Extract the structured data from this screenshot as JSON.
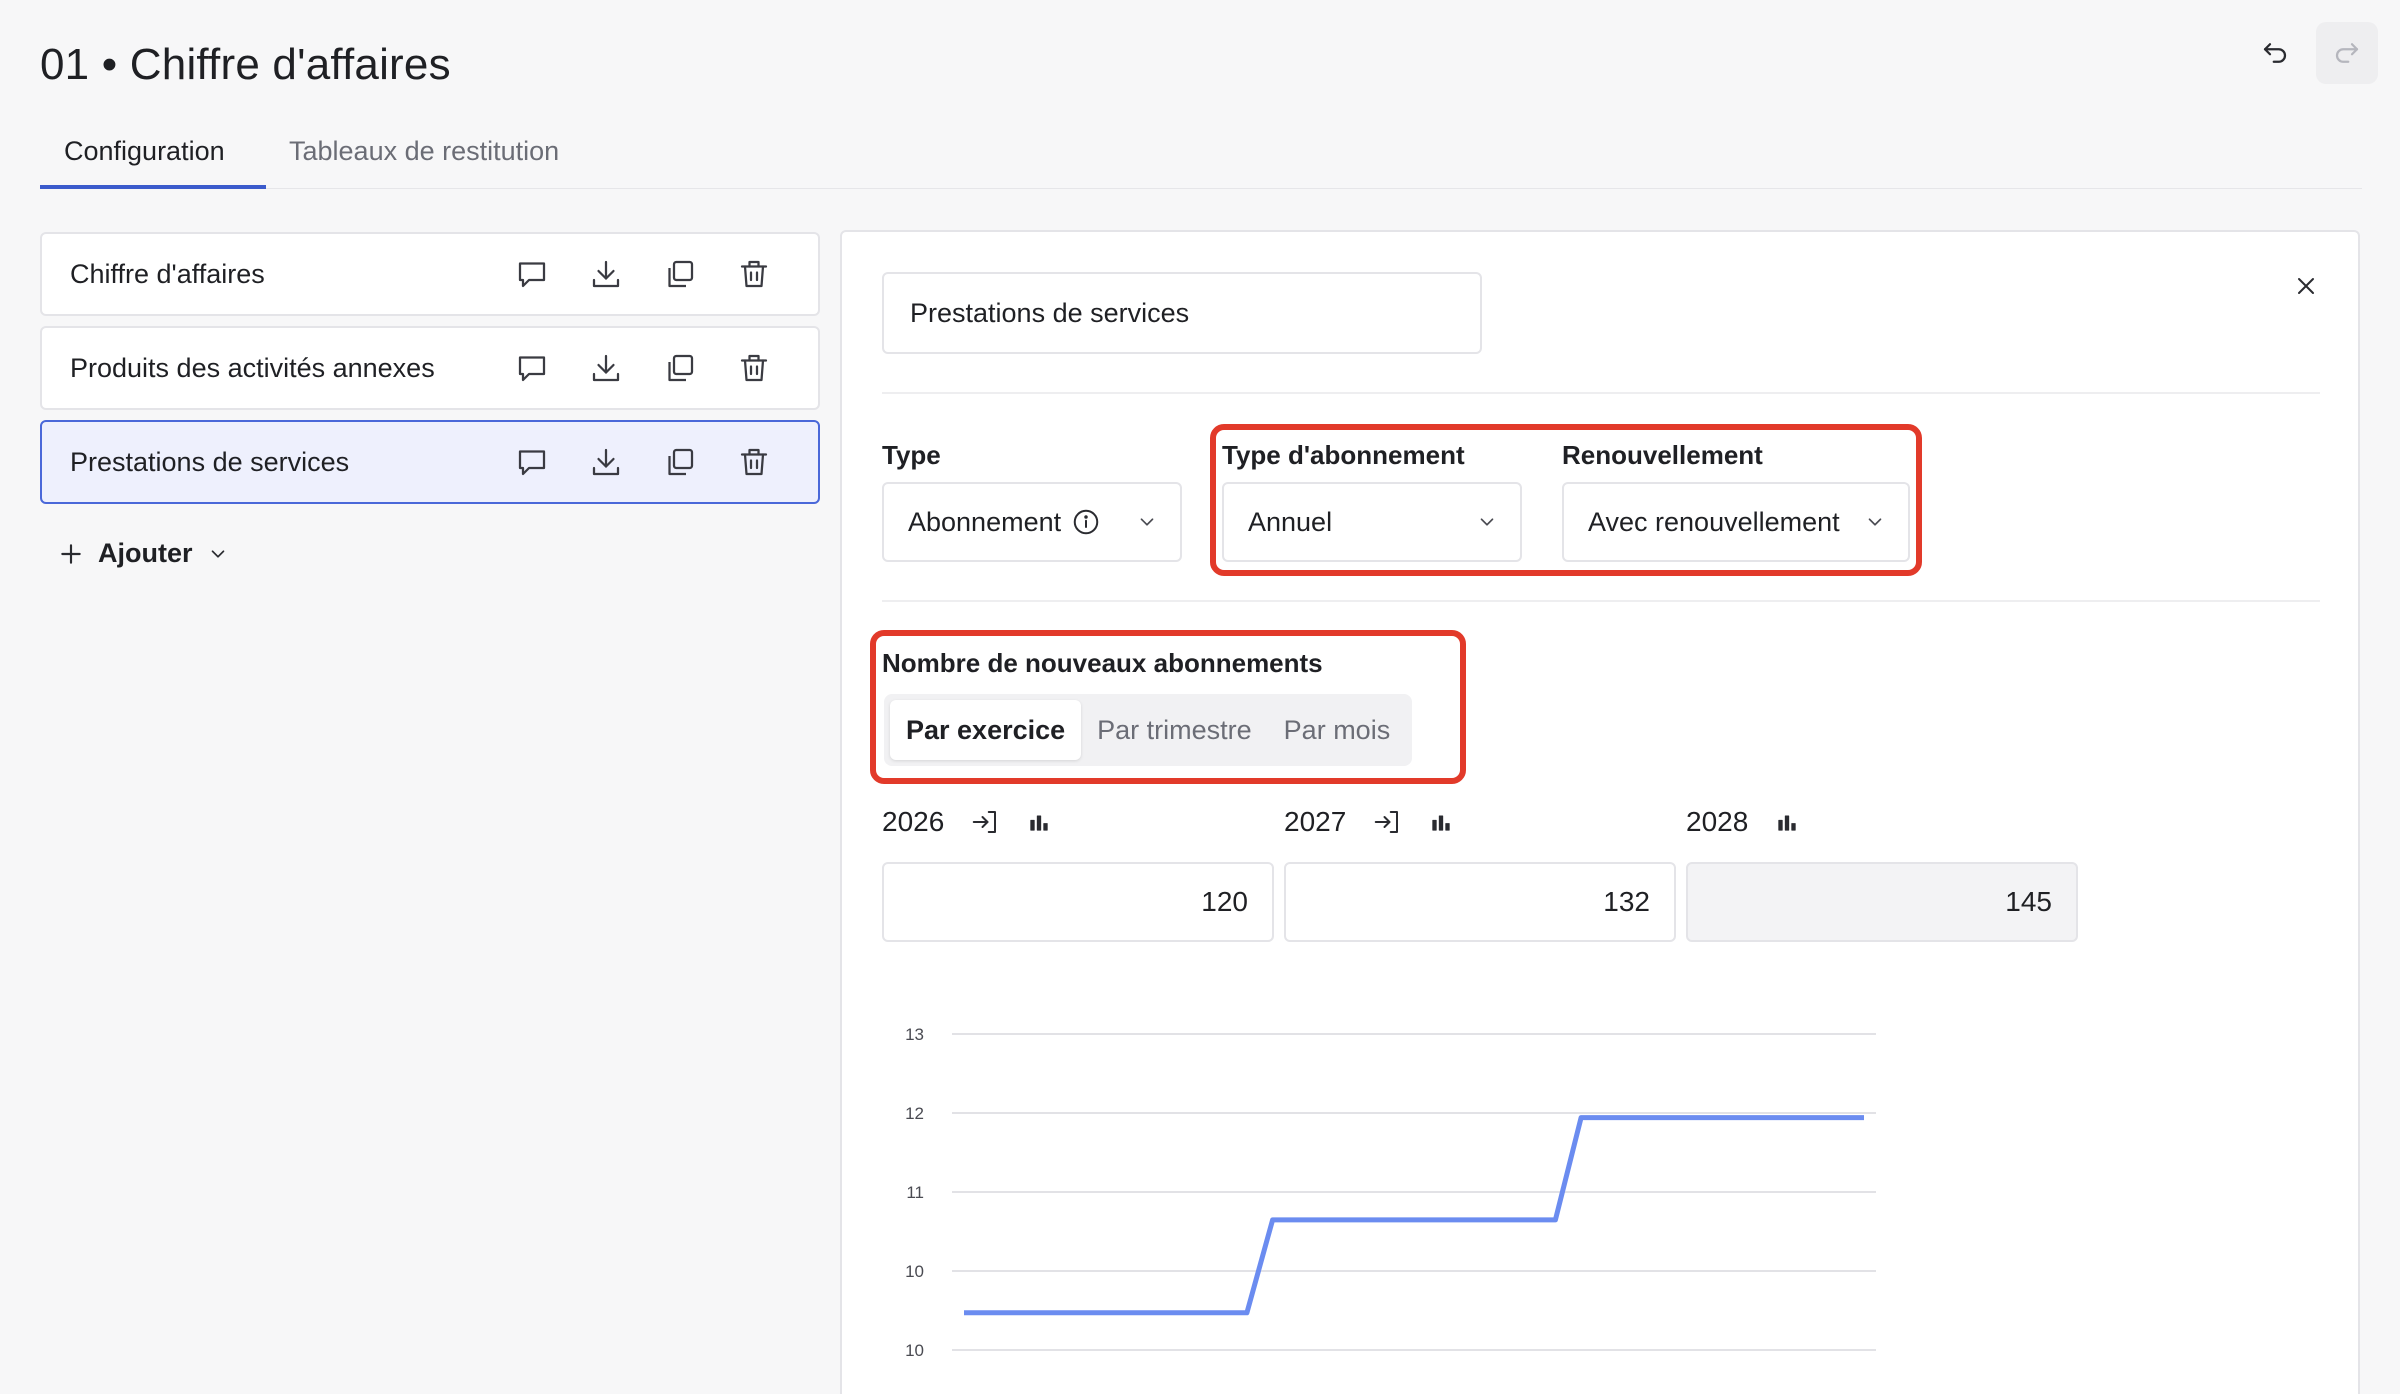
{
  "header": {
    "title": "01 • Chiffre d'affaires",
    "tabs": [
      {
        "label": "Configuration",
        "active": true
      },
      {
        "label": "Tableaux de restitution",
        "active": false
      }
    ]
  },
  "sidebar": {
    "items": [
      {
        "label": "Chiffre d'affaires",
        "selected": false
      },
      {
        "label": "Produits des activités annexes",
        "selected": false
      },
      {
        "label": "Prestations de services",
        "selected": true
      }
    ],
    "add_label": "Ajouter"
  },
  "panel": {
    "name_value": "Prestations de services",
    "type": {
      "label": "Type",
      "value": "Abonnement"
    },
    "subscription_type": {
      "label": "Type d'abonnement",
      "value": "Annuel"
    },
    "renewal": {
      "label": "Renouvellement",
      "value": "Avec renouvellement"
    },
    "new_subs": {
      "label": "Nombre de nouveaux abonnements",
      "periods": [
        "Par exercice",
        "Par trimestre",
        "Par mois"
      ],
      "active_period": "Par exercice"
    },
    "years": [
      {
        "year": "2026",
        "value": "120",
        "has_apply": true,
        "readonly": false
      },
      {
        "year": "2027",
        "value": "132",
        "has_apply": true,
        "readonly": false
      },
      {
        "year": "2028",
        "value": "145",
        "has_apply": false,
        "readonly": true
      }
    ]
  },
  "colors": {
    "accent": "#3b5bcc",
    "highlight": "#e23a2a",
    "line": "#6b8cf0"
  },
  "chart_data": {
    "type": "line",
    "ytick_labels": [
      "13",
      "12",
      "11",
      "10",
      "10"
    ],
    "x": [
      1,
      2,
      3,
      4,
      5,
      6,
      7,
      8,
      9,
      10,
      11,
      12,
      13,
      14,
      15,
      16,
      17,
      18,
      19,
      20,
      21,
      22,
      23,
      24,
      25,
      26,
      27,
      28,
      29,
      30,
      31,
      32,
      33,
      34,
      35,
      36
    ],
    "values": [
      10.0,
      10.0,
      10.0,
      10.0,
      10.0,
      10.0,
      10.0,
      10.0,
      10.0,
      10.0,
      10.0,
      10.0,
      11.0,
      11.0,
      11.0,
      11.0,
      11.0,
      11.0,
      11.0,
      11.0,
      11.0,
      11.0,
      11.0,
      11.0,
      12.1,
      12.1,
      12.1,
      12.1,
      12.1,
      12.1,
      12.1,
      12.1,
      12.1,
      12.1,
      12.1,
      12.1
    ],
    "ylim": [
      9.5,
      13.5
    ],
    "grid": true
  }
}
